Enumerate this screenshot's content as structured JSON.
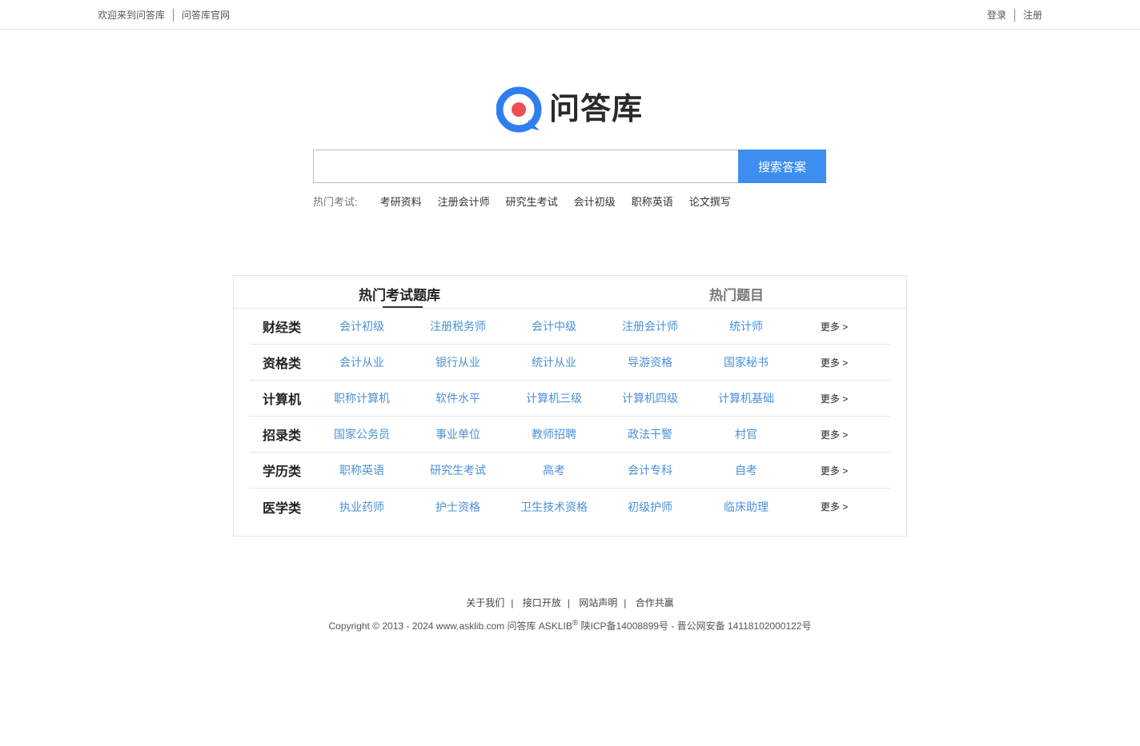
{
  "topbar": {
    "welcome": "欢迎来到问答库",
    "official": "问答库官网",
    "login": "登录",
    "register": "注册"
  },
  "logo": {
    "text": "问答库",
    "icon": "q-logo-icon",
    "colors": {
      "blue": "#2f7ef0",
      "red": "#ef4f4f"
    }
  },
  "search": {
    "value": "",
    "placeholder": "",
    "button": "搜索答案",
    "button_color": "#3d8ef0"
  },
  "hot": {
    "label": "热门考试:",
    "items": [
      "考研资料",
      "注册会计师",
      "研究生考试",
      "会计初级",
      "职称英语",
      "论文撰写"
    ]
  },
  "panel": {
    "tabs": [
      "热门考试题库",
      "热门题目"
    ],
    "more_label": "更多 >",
    "rows": [
      {
        "category": "财经类",
        "links": [
          "会计初级",
          "注册税务师",
          "会计中级",
          "注册会计师",
          "统计师"
        ]
      },
      {
        "category": "资格类",
        "links": [
          "会计从业",
          "银行从业",
          "统计从业",
          "导游资格",
          "国家秘书"
        ]
      },
      {
        "category": "计算机",
        "links": [
          "职称计算机",
          "软件水平",
          "计算机三级",
          "计算机四级",
          "计算机基础"
        ]
      },
      {
        "category": "招录类",
        "links": [
          "国家公务员",
          "事业单位",
          "教师招聘",
          "政法干警",
          "村官"
        ]
      },
      {
        "category": "学历类",
        "links": [
          "职称英语",
          "研究生考试",
          "高考",
          "会计专科",
          "自考"
        ]
      },
      {
        "category": "医学类",
        "links": [
          "执业药师",
          "护士资格",
          "卫生技术资格",
          "初级护师",
          "临床助理"
        ]
      }
    ],
    "link_color": "#4a90d9"
  },
  "footer": {
    "links": [
      "关于我们",
      "接口开放",
      "网站声明",
      "合作共赢"
    ],
    "copyright_pre": "Copyright © 2013 - 2024 www.asklib.com  问答库  ASKLIB",
    "registered": "®",
    "copyright_post": " 陕ICP备14008899号 - 晋公网安备 14118102000122号"
  }
}
